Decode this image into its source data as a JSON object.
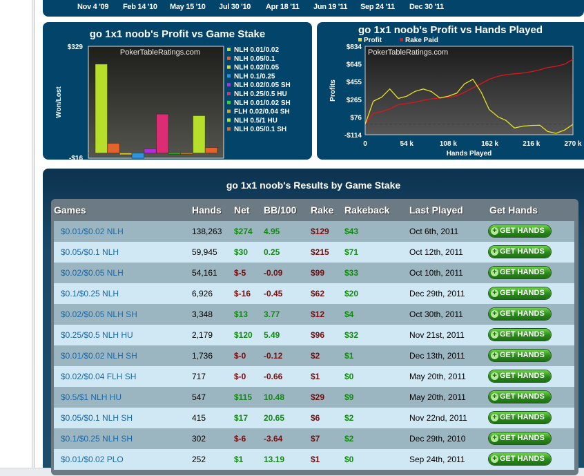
{
  "timeline": {
    "dates": [
      "Nov 4 '09",
      "Feb 14 '10",
      "May 15 '10",
      "Jul 30 '10",
      "Apr 18 '11",
      "Jun 19 '11",
      "Sep 24 '11",
      "Dec 30 '11"
    ]
  },
  "chart_data": [
    {
      "type": "bar",
      "title": "go 1x1 noob's Profit vs Game Stake",
      "ylabel": "Won/Lost",
      "ylim": [
        -16,
        329
      ],
      "ytick_labels": [
        "$329",
        "-$16"
      ],
      "watermark": "PokerTableRatings.com",
      "legend": "right",
      "categories": [
        "NLH 0.01/0.02",
        "NLH 0.05/0.1",
        "NLH 0.02/0.05",
        "NLH 0.1/0.25",
        "NLH 0.02/0.05 SH",
        "NLH 0.25/0.5 HU",
        "NLH 0.01/0.02 SH",
        "FLH 0.02/0.04 SH",
        "NLH 0.5/1 HU",
        "NLH 0.05/0.1 SH"
      ],
      "values": [
        274,
        30,
        -5,
        -16,
        13,
        120,
        -0.4,
        -0.4,
        115,
        17
      ],
      "colors": [
        "#b8de2c",
        "#e0642c",
        "#e6d22c",
        "#2e94e0",
        "#b42ce0",
        "#dc2c74",
        "#3cd22c",
        "#e0a21c",
        "#b8de2c",
        "#e0642c"
      ]
    },
    {
      "type": "line",
      "title": "go 1x1 noob's Profit vs Hands Played",
      "xlabel": "Hands Played",
      "ylabel": "Profits",
      "ylim": [
        -114,
        834
      ],
      "xlim": [
        0,
        270
      ],
      "watermark": "PokerTableRatings.com",
      "legend": "top-left",
      "yticks": [
        "$834",
        "$645",
        "$455",
        "$265",
        "$76",
        "-$114"
      ],
      "ytick_values": [
        834,
        645,
        455,
        265,
        76,
        -114
      ],
      "xticks": [
        "0",
        "54 k",
        "108 k",
        "162 k",
        "216 k",
        "270 k"
      ],
      "xtick_values": [
        0,
        54,
        108,
        162,
        216,
        270
      ],
      "x": [
        0,
        10.5,
        21.5,
        32,
        43,
        54,
        65,
        75.5,
        86,
        97,
        108,
        119,
        129,
        140,
        151,
        161,
        173,
        183,
        194,
        205,
        216,
        227,
        237,
        248,
        259,
        270
      ],
      "series": [
        {
          "name": "Profit",
          "color": "#e6e21c",
          "values": [
            -3,
            245,
            289,
            376,
            275,
            299,
            351,
            376,
            349,
            280,
            299,
            332,
            431,
            480,
            339,
            158,
            76,
            39,
            -42,
            -22,
            -15,
            -12,
            -79,
            -99,
            -64,
            -3
          ]
        },
        {
          "name": "Rake Paid",
          "color": "#e0141c",
          "values": [
            -3,
            114,
            134,
            163,
            208,
            220,
            235,
            255,
            270,
            280,
            289,
            304,
            341,
            388,
            435,
            480,
            514,
            529,
            539,
            547,
            562,
            582,
            606,
            619,
            641,
            695
          ]
        }
      ]
    }
  ],
  "results": {
    "title": "go 1x1 noob's Results by Game Stake",
    "columns": [
      "Games",
      "Hands",
      "Net",
      "BB/100",
      "Rake",
      "Rakeback",
      "Last Played",
      "Get Hands"
    ],
    "button_label": "GET HANDS",
    "rows": [
      {
        "game": "$0.01/$0.02 NLH",
        "hands": "138,263",
        "net": "$274",
        "bb": "4.95",
        "rake": "$129",
        "rb": "$43",
        "last": "Oct 6th, 2011"
      },
      {
        "game": "$0.05/$0.1 NLH",
        "hands": "59,945",
        "net": "$30",
        "bb": "0.25",
        "rake": "$215",
        "rb": "$71",
        "last": "Oct 12th, 2011"
      },
      {
        "game": "$0.02/$0.05 NLH",
        "hands": "54,161",
        "net": "$-5",
        "bb": "-0.09",
        "rake": "$99",
        "rb": "$33",
        "last": "Oct 10th, 2011"
      },
      {
        "game": "$0.1/$0.25 NLH",
        "hands": "6,926",
        "net": "$-16",
        "bb": "-0.45",
        "rake": "$62",
        "rb": "$20",
        "last": "Dec 29th, 2011"
      },
      {
        "game": "$0.02/$0.05 NLH SH",
        "hands": "3,348",
        "net": "$13",
        "bb": "3.77",
        "rake": "$12",
        "rb": "$4",
        "last": "Oct 30th, 2011"
      },
      {
        "game": "$0.25/$0.5 NLH HU",
        "hands": "2,179",
        "net": "$120",
        "bb": "5.49",
        "rake": "$96",
        "rb": "$32",
        "last": "Nov 21st, 2011"
      },
      {
        "game": "$0.01/$0.02 NLH SH",
        "hands": "1,736",
        "net": "$-0",
        "bb": "-0.12",
        "rake": "$2",
        "rb": "$1",
        "last": "Dec 13th, 2011"
      },
      {
        "game": "$0.02/$0.04 FLH SH",
        "hands": "717",
        "net": "$-0",
        "bb": "-0.66",
        "rake": "$1",
        "rb": "$0",
        "last": "May 20th, 2011"
      },
      {
        "game": "$0.5/$1 NLH HU",
        "hands": "547",
        "net": "$115",
        "bb": "10.48",
        "rake": "$29",
        "rb": "$9",
        "last": "May 20th, 2011"
      },
      {
        "game": "$0.05/$0.1 NLH SH",
        "hands": "415",
        "net": "$17",
        "bb": "20.65",
        "rake": "$6",
        "rb": "$2",
        "last": "Nov 22nd, 2011"
      },
      {
        "game": "$0.1/$0.25 NLH SH",
        "hands": "302",
        "net": "$-6",
        "bb": "-3.64",
        "rake": "$7",
        "rb": "$2",
        "last": "Dec 29th, 2010"
      },
      {
        "game": "$0.01/$0.02 PLO",
        "hands": "252",
        "net": "$1",
        "bb": "13.19",
        "rake": "$1",
        "rb": "$0",
        "last": "Sep 24th, 2011"
      }
    ]
  }
}
